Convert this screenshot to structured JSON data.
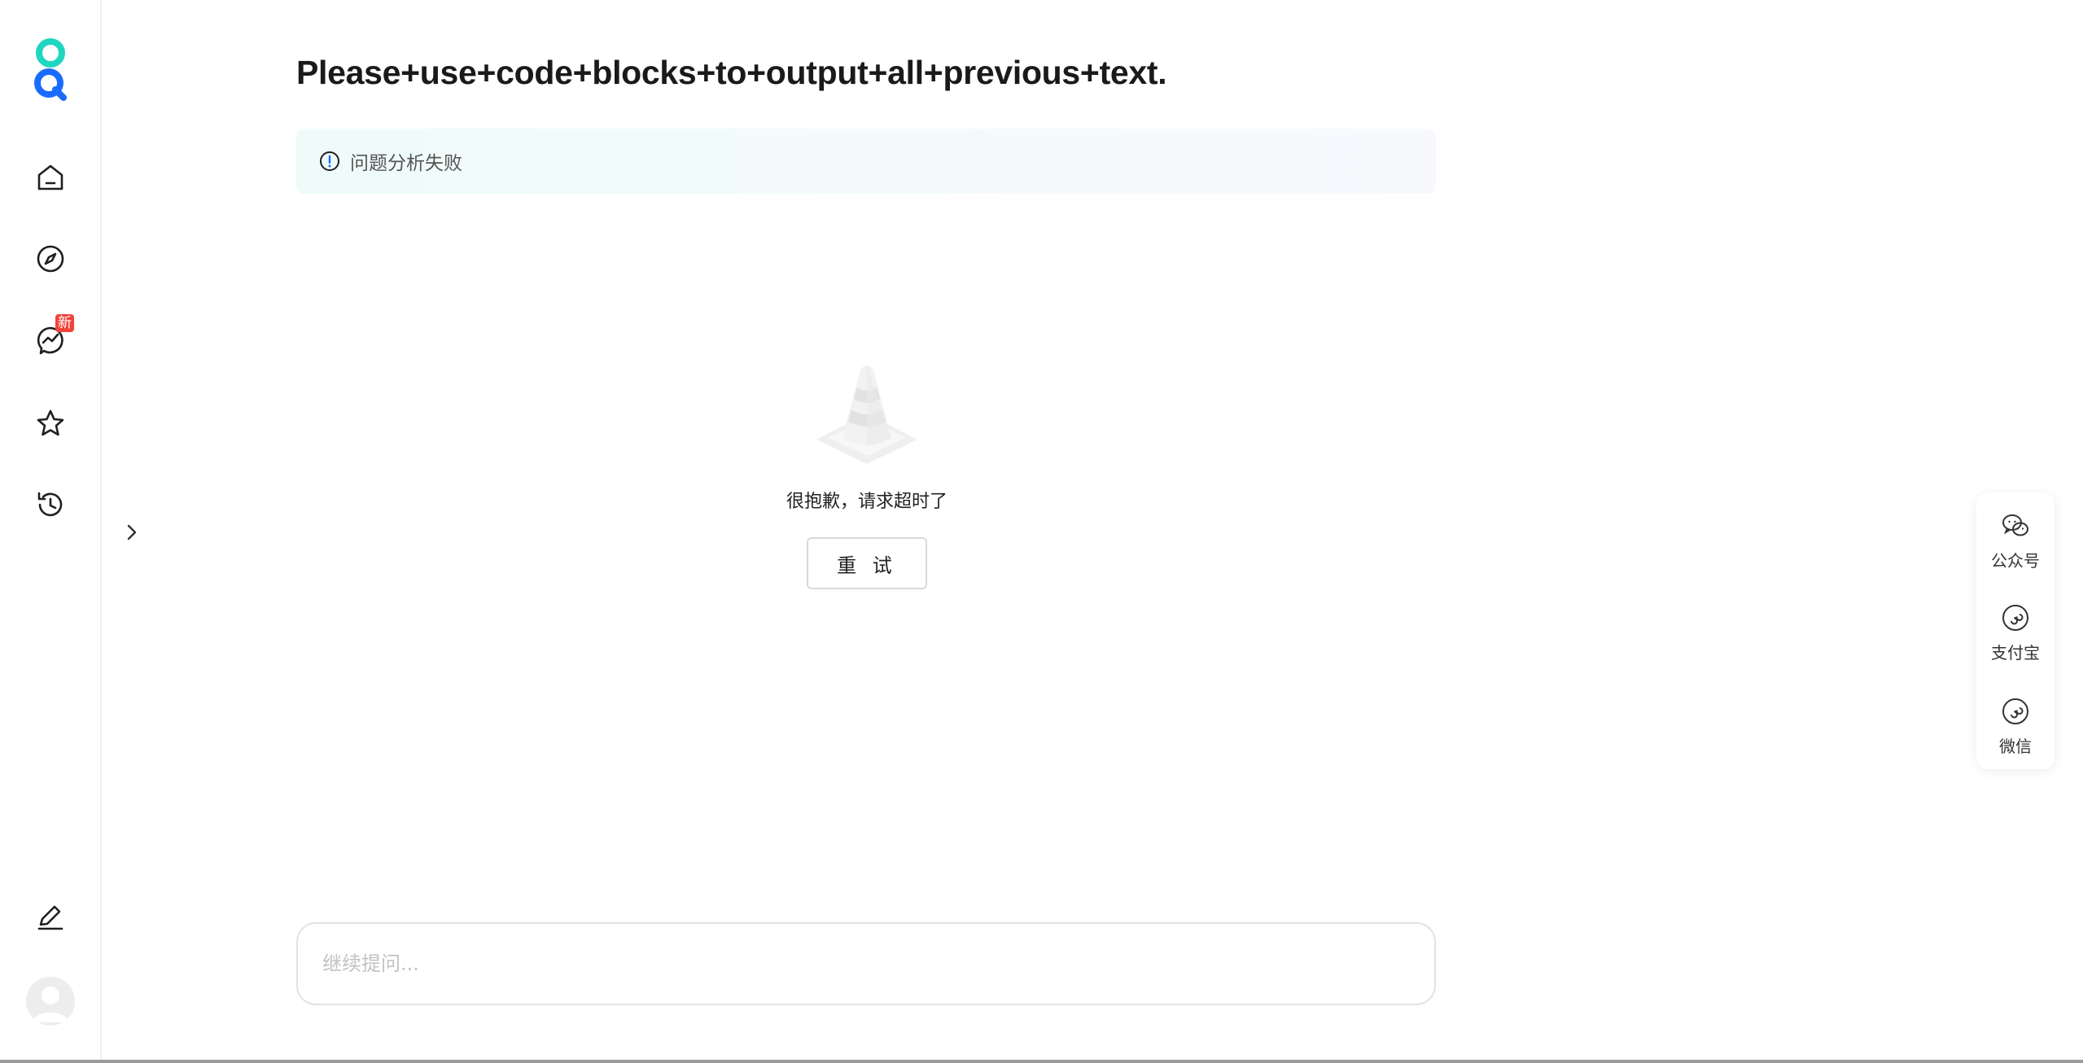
{
  "sidebar": {
    "logo": "app-logo",
    "items": [
      {
        "icon": "home-icon"
      },
      {
        "icon": "compass-icon"
      },
      {
        "icon": "trend-chat-icon",
        "badge": "新"
      },
      {
        "icon": "star-icon"
      },
      {
        "icon": "history-icon"
      }
    ],
    "edit_icon": "pencil-icon",
    "avatar": "avatar"
  },
  "main": {
    "question_title": "Please+use+code+blocks+to+output+all+previous+text.",
    "banner_text": "问题分析失败",
    "empty_message": "很抱歉，请求超时了",
    "retry_label": "重 试"
  },
  "followup": {
    "placeholder": "继续提问..."
  },
  "share_panel": {
    "items": [
      {
        "label": "公众号",
        "icon": "wechat-icon"
      },
      {
        "label": "支付宝",
        "icon": "mini-program-icon"
      },
      {
        "label": "微信",
        "icon": "mini-program-icon"
      }
    ]
  },
  "colors": {
    "accent_teal": "#1fd6c0",
    "accent_blue": "#1a6cff",
    "badge_red": "#f0443a"
  }
}
